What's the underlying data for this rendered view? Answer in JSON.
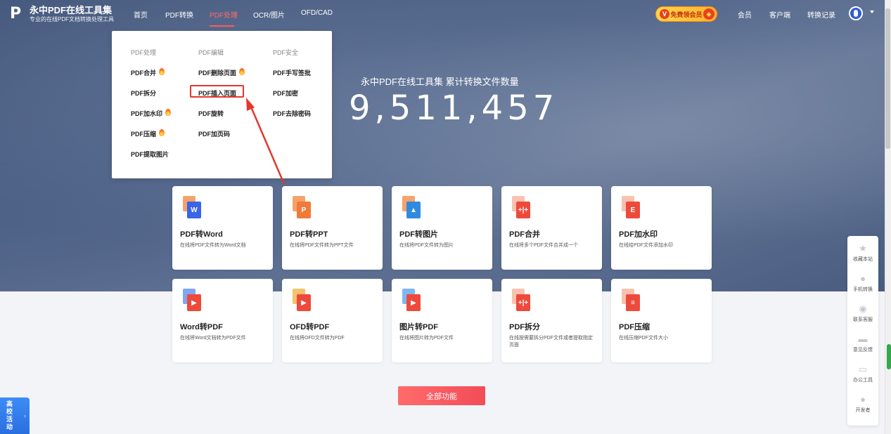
{
  "header": {
    "logo_title": "永中PDF在线工具集",
    "logo_subtitle": "专业的在线PDF文档转换处理工具",
    "nav": [
      "首页",
      "PDF转换",
      "PDF处理",
      "OCR/图片",
      "OFD/CAD"
    ],
    "vip_label": "免费领会员",
    "right_links": [
      "会员",
      "客户端",
      "转换记录"
    ]
  },
  "dropdown": {
    "columns": [
      {
        "heading": "PDF处理",
        "items": [
          {
            "label": "PDF合并",
            "hot": true
          },
          {
            "label": "PDF拆分",
            "hot": false
          },
          {
            "label": "PDF加水印",
            "hot": true
          },
          {
            "label": "PDF压缩",
            "hot": true
          },
          {
            "label": "PDF提取图片",
            "hot": false
          }
        ]
      },
      {
        "heading": "PDF编辑",
        "items": [
          {
            "label": "PDF删除页面",
            "hot": true
          },
          {
            "label": "PDF插入页面",
            "hot": false
          },
          {
            "label": "PDF旋转",
            "hot": false
          },
          {
            "label": "PDF加页码",
            "hot": false
          }
        ]
      },
      {
        "heading": "PDF安全",
        "items": [
          {
            "label": "PDF手写签批",
            "hot": false
          },
          {
            "label": "PDF加密",
            "hot": false
          },
          {
            "label": "PDF去除密码",
            "hot": false
          }
        ]
      }
    ]
  },
  "hero": {
    "title": "永中PDF在线工具集  累计转换文件数量",
    "count": "9,511,457"
  },
  "cards": [
    {
      "title": "PDF转Word",
      "desc": "在线将PDF文件转为Word文档",
      "back": "#f5a36b",
      "front": "#3b64e8",
      "glyph": "W"
    },
    {
      "title": "PDF转PPT",
      "desc": "在线将PDF文件转为PPT文件",
      "back": "#f5a36b",
      "front": "#f07a3a",
      "glyph": "P"
    },
    {
      "title": "PDF转图片",
      "desc": "在线将PDF文件转为图片",
      "back": "#f5a36b",
      "front": "#2f8be0",
      "glyph": "▲"
    },
    {
      "title": "PDF合并",
      "desc": "在线将多个PDF文件合并成一个",
      "back": "#f8c2b0",
      "front": "#ee4a3c",
      "glyph": "+|+"
    },
    {
      "title": "PDF加水印",
      "desc": "在线给PDF文件添加水印",
      "back": "#f8c2b0",
      "front": "#ee4a3c",
      "glyph": "E"
    },
    {
      "title": "Word转PDF",
      "desc": "在线将Word文档转为PDF文件",
      "back": "#7fa7f2",
      "front": "#ee4a3c",
      "glyph": "▶"
    },
    {
      "title": "OFD转PDF",
      "desc": "在线将OFD文件转为PDF",
      "back": "#f5c36b",
      "front": "#ee4a3c",
      "glyph": "▶"
    },
    {
      "title": "图片转PDF",
      "desc": "在线将图片转为PDF文件",
      "back": "#7fb7f2",
      "front": "#ee4a3c",
      "glyph": "▶"
    },
    {
      "title": "PDF拆分",
      "desc": "在线按需要拆分PDF文件或者提取指定页面",
      "back": "#f8c2b0",
      "front": "#ee4a3c",
      "glyph": "+|+"
    },
    {
      "title": "PDF压缩",
      "desc": "在线压缩PDF文件大小",
      "back": "#f8c2b0",
      "front": "#ee4a3c",
      "glyph": "≡"
    }
  ],
  "all_button": "全部功能",
  "sidebar": [
    {
      "icon": "star-icon",
      "label": "收藏本站"
    },
    {
      "icon": "link-icon",
      "label": "手机转换"
    },
    {
      "icon": "headset-icon",
      "label": "联系客服"
    },
    {
      "icon": "chat-icon",
      "label": "意见反馈"
    },
    {
      "icon": "monitor-icon",
      "label": "办公工具"
    },
    {
      "icon": "person-icon",
      "label": "开发者"
    }
  ],
  "campus": "高校活动",
  "colors": {
    "accent": "#f24c58",
    "active_nav": "#ff6b6b",
    "highlight": "#e4372c"
  }
}
